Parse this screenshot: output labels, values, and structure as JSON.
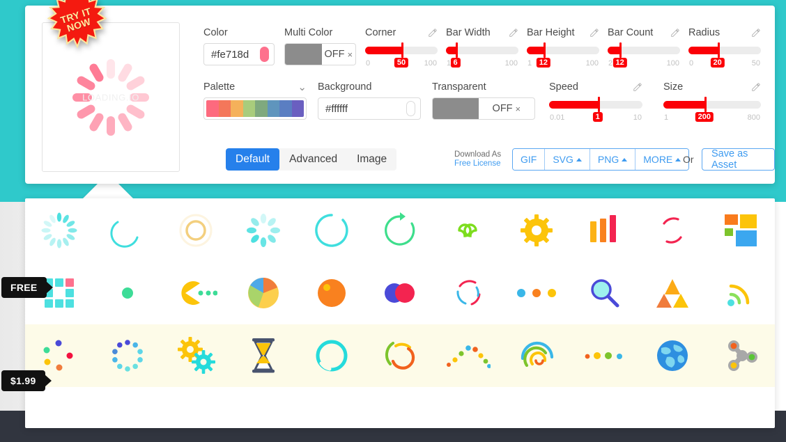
{
  "badges": {
    "try_line1": "TRY IT",
    "try_line2": "NOW",
    "free": "FREE",
    "price": "$1.99"
  },
  "preview": {
    "watermark": "LOADING.IO",
    "bar_count": 12,
    "color": "#fe718d"
  },
  "controls": {
    "color": {
      "label": "Color",
      "value": "#fe718d",
      "swatch": "#fe718d"
    },
    "multi_color": {
      "label": "Multi Color",
      "state": "OFF",
      "state_mark": "×"
    },
    "corner": {
      "label": "Corner",
      "min": "0",
      "max": "100",
      "value": "50",
      "percent": 50
    },
    "bar_width": {
      "label": "Bar Width",
      "min": "1",
      "max": "100",
      "value": "6",
      "percent": 6
    },
    "bar_height": {
      "label": "Bar Height",
      "min": "1",
      "max": "100",
      "value": "12",
      "percent": 12
    },
    "bar_count": {
      "label": "Bar Count",
      "min": "2",
      "max": "100",
      "value": "12",
      "percent": 12
    },
    "radius": {
      "label": "Radius",
      "min": "0",
      "max": "50",
      "value": "20",
      "percent": 40
    },
    "palette": {
      "label": "Palette",
      "chevron": "⌄⌄",
      "colors": [
        "#fd6a7e",
        "#f4775a",
        "#f5b15a",
        "#a9cc7c",
        "#7fa97e",
        "#5f95bd",
        "#5a7ec2",
        "#6a5fc0"
      ]
    },
    "background": {
      "label": "Background",
      "value": "#ffffff"
    },
    "transparent": {
      "label": "Transparent",
      "state": "OFF",
      "state_mark": "×"
    },
    "speed": {
      "label": "Speed",
      "min": "0.01",
      "max": "10",
      "value": "1",
      "percent": 52
    },
    "size": {
      "label": "Size",
      "min": "1",
      "max": "800",
      "value": "200",
      "percent": 42
    }
  },
  "tabs": [
    {
      "label": "Default",
      "active": true
    },
    {
      "label": "Advanced",
      "active": false
    },
    {
      "label": "Image",
      "active": false
    }
  ],
  "download": {
    "title": "Download As",
    "license": "Free License",
    "buttons": [
      "GIF",
      "SVG",
      "PNG",
      "MORE"
    ],
    "or": "Or",
    "save_asset": "Save as Asset"
  },
  "gallery": {
    "rows": [
      {
        "paid": false,
        "items": [
          "spinner-petals-icon",
          "crescent-arc-icon",
          "double-ring-icon",
          "petal-spinner-icon",
          "ring-arc-icon",
          "reload-arrow-icon",
          "infinity-icon",
          "gear-icon",
          "bar-chart-icon",
          "split-ring-icon",
          "squares-grid-icon"
        ]
      },
      {
        "paid": false,
        "items": [
          "grid-blocks-icon",
          "single-dot-icon",
          "pacman-icon",
          "pie-chart-icon",
          "orange-ball-icon",
          "two-circles-icon",
          "dual-dashed-ring-icon",
          "three-dots-icon",
          "magnifier-icon",
          "triangles-icon",
          "wifi-signal-icon"
        ]
      },
      {
        "paid": true,
        "items": [
          "scatter-dots-icon",
          "dotted-ring-icon",
          "two-gears-icon",
          "hourglass-icon",
          "cyan-ring-icon",
          "multi-arc-spinner-icon",
          "dot-arch-icon",
          "nested-arcs-icon",
          "four-dots-icon",
          "globe-icon",
          "fidget-spinner-icon"
        ]
      }
    ]
  }
}
